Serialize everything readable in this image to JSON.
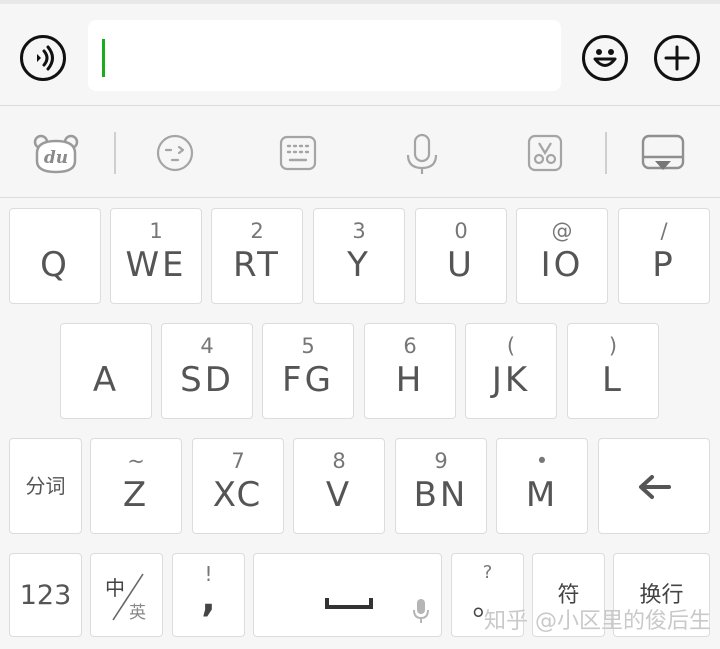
{
  "input": {
    "value": ""
  },
  "keyboard": {
    "row1": [
      {
        "sub": "",
        "main": "Q"
      },
      {
        "sub": "1",
        "main": "WE"
      },
      {
        "sub": "2",
        "main": "RT"
      },
      {
        "sub": "3",
        "main": "Y"
      },
      {
        "sub": "0",
        "main": "U"
      },
      {
        "sub": "@",
        "main": "IO"
      },
      {
        "sub": "/",
        "main": "P"
      }
    ],
    "row2": [
      {
        "sub": "",
        "main": "A"
      },
      {
        "sub": "4",
        "main": "SD"
      },
      {
        "sub": "5",
        "main": "FG"
      },
      {
        "sub": "6",
        "main": "H"
      },
      {
        "sub": "(",
        "main": "JK"
      },
      {
        "sub": ")",
        "main": "L"
      }
    ],
    "row3": {
      "fenci": "分词",
      "keys": [
        {
          "sub": "~",
          "main": "Z"
        },
        {
          "sub": "7",
          "main": "XC"
        },
        {
          "sub": "8",
          "main": "V"
        },
        {
          "sub": "9",
          "main": "BN"
        },
        {
          "sub": "•",
          "main": "M"
        }
      ]
    },
    "row4": {
      "num": "123",
      "lang_top": "中",
      "lang_bottom": "英",
      "comma_sub": "!",
      "comma_main": ",",
      "period_sub": "?",
      "period_main": "。",
      "symbol": "符",
      "enter": "换行"
    }
  },
  "watermark": "知乎 @小区里的俊后生",
  "colors": {
    "caret": "#1aad19"
  }
}
